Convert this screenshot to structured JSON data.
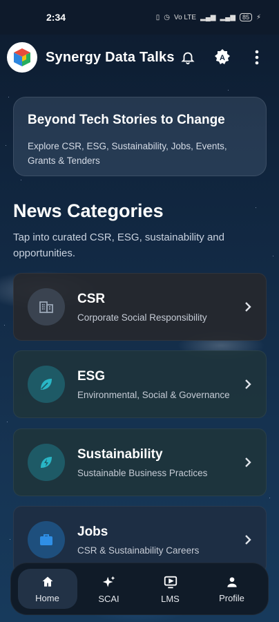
{
  "status_bar": {
    "time": "2:34",
    "network": "Vo LTE",
    "battery": "85"
  },
  "app_bar": {
    "title": "Synergy Data Talks",
    "icons": [
      "bell-icon",
      "translate-icon",
      "more-vert-icon"
    ]
  },
  "hero": {
    "title": "Beyond Tech Stories to Change",
    "subtitle": "Explore CSR, ESG, Sustainability, Jobs, Events, Grants & Tenders"
  },
  "section": {
    "title": "News Categories",
    "subtitle": "Tap into curated CSR, ESG, sustainability and opportunities."
  },
  "categories": [
    {
      "title": "CSR",
      "subtitle": "Corporate Social Responsibility",
      "icon": "building-icon",
      "color": "#3a4350"
    },
    {
      "title": "ESG",
      "subtitle": "Environmental, Social & Governance",
      "icon": "leaf-icon",
      "color": "#1e5a66"
    },
    {
      "title": "Sustainability",
      "subtitle": "Sustainable Business Practices",
      "icon": "eco-bolt-icon",
      "color": "#1e5a66"
    },
    {
      "title": "Jobs",
      "subtitle": "CSR & Sustainability Careers",
      "icon": "briefcase-icon",
      "color": "#1e4f7d"
    }
  ],
  "bottom_nav": {
    "items": [
      {
        "label": "Home",
        "icon": "home-icon",
        "active": true
      },
      {
        "label": "SCAI",
        "icon": "sparkle-icon",
        "active": false
      },
      {
        "label": "LMS",
        "icon": "video-icon",
        "active": false
      },
      {
        "label": "Profile",
        "icon": "person-icon",
        "active": false
      }
    ]
  },
  "colors": {
    "accent_teal": "#29b6c6",
    "accent_blue": "#2f8fe6",
    "nav_bg": "#101b28"
  }
}
